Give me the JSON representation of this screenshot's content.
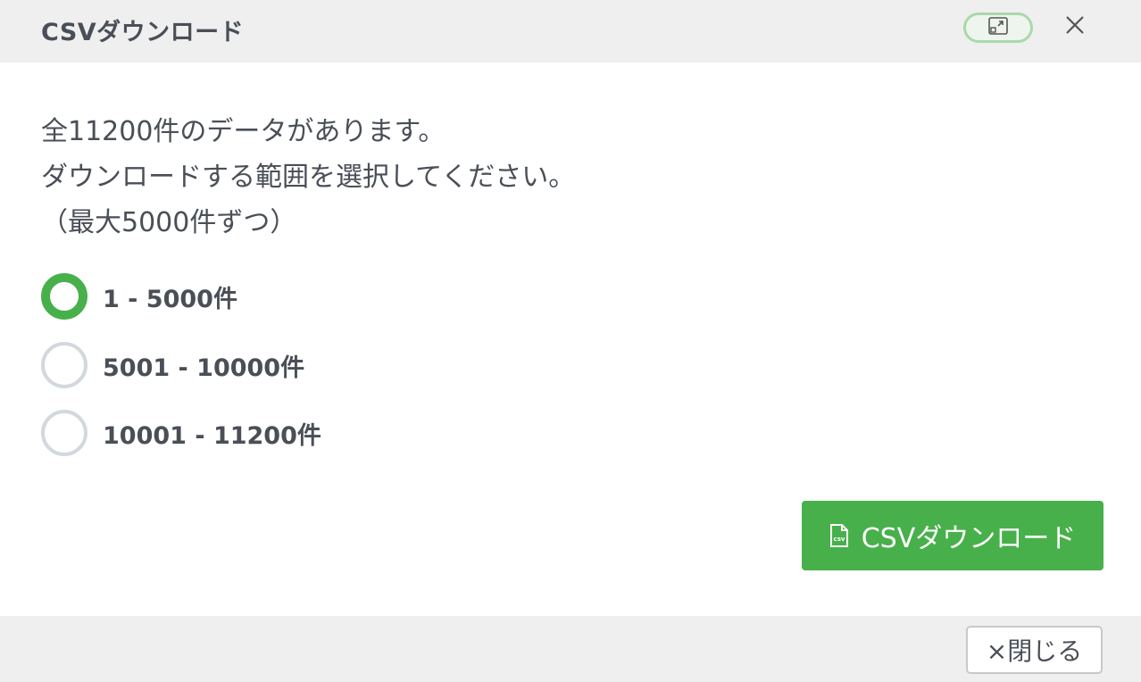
{
  "header": {
    "title": "CSVダウンロード"
  },
  "body": {
    "message_line1": "全11200件のデータがあります。",
    "message_line2": "ダウンロードする範囲を選択してください。",
    "message_line3": "（最大5000件ずつ）"
  },
  "options": [
    {
      "label": "1 - 5000件",
      "selected": true
    },
    {
      "label": "5001 - 10000件",
      "selected": false
    },
    {
      "label": "10001 - 11200件",
      "selected": false
    }
  ],
  "download_button": {
    "label": "CSVダウンロード",
    "icon": "csv-file-icon"
  },
  "footer": {
    "close_label": "×閉じる"
  },
  "colors": {
    "accent": "#48b04b",
    "header_bg": "#efefef",
    "text": "#4a4f57",
    "radio_border": "#d3d8df"
  }
}
